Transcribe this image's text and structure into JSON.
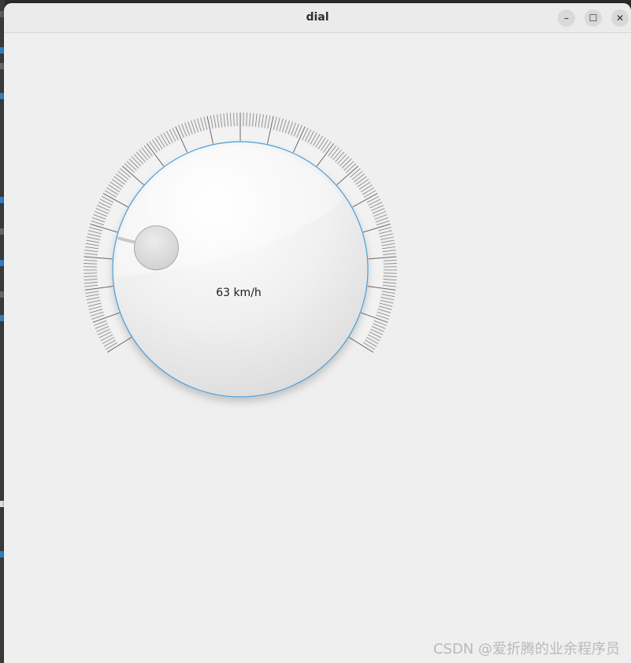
{
  "window": {
    "title": "dial",
    "minimize_glyph": "–",
    "maximize_glyph": "☐",
    "close_glyph": "✕"
  },
  "dial": {
    "readout": "63 km/h",
    "value": 63,
    "unit": "km/h",
    "accent_color": "#4a9fd8"
  },
  "watermark": "CSDN @爱折腾的业余程序员"
}
